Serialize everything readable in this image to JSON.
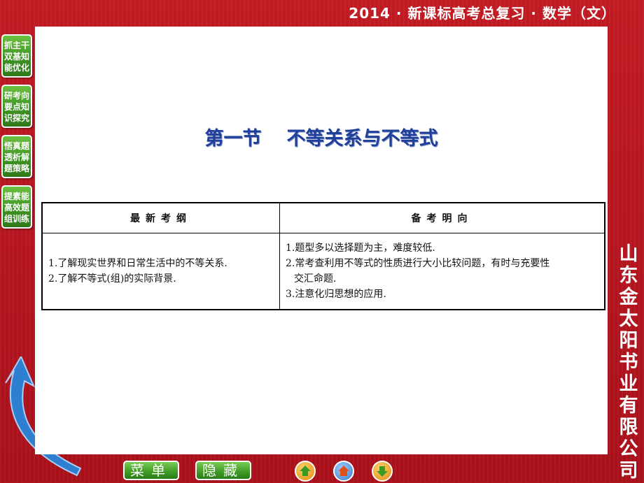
{
  "header": {
    "title": "2014 · 新课标高考总复习 · 数学（文）"
  },
  "sidebar": {
    "items": [
      {
        "label": "抓主干双基知能优化"
      },
      {
        "label": "研考向要点知识探究"
      },
      {
        "label": "悟真题透析解题策略"
      },
      {
        "label": "提素能高效题组训练"
      }
    ]
  },
  "main": {
    "title_part1": "第一节",
    "title_part2": "不等关系与不等式",
    "table": {
      "headers": [
        "最新考纲",
        "备考明向"
      ],
      "left_lines": [
        "1.了解现实世界和日常生活中的不等关系.",
        "2.了解不等式(组)的实际背景."
      ],
      "right_lines": [
        "1.题型多以选择题为主，难度较低.",
        "2.常考查利用不等式的性质进行大小比较问题，有时与充要性",
        "交汇命题.",
        "3.注意化归思想的应用."
      ]
    }
  },
  "company": {
    "name": "山东金太阳书业有限公司"
  },
  "bottom": {
    "menu_label": "菜单",
    "hide_label": "隐藏"
  },
  "colors": {
    "background": "#b8141e",
    "title_blue": "#1f3f9a",
    "button_green": "#3e9423"
  }
}
